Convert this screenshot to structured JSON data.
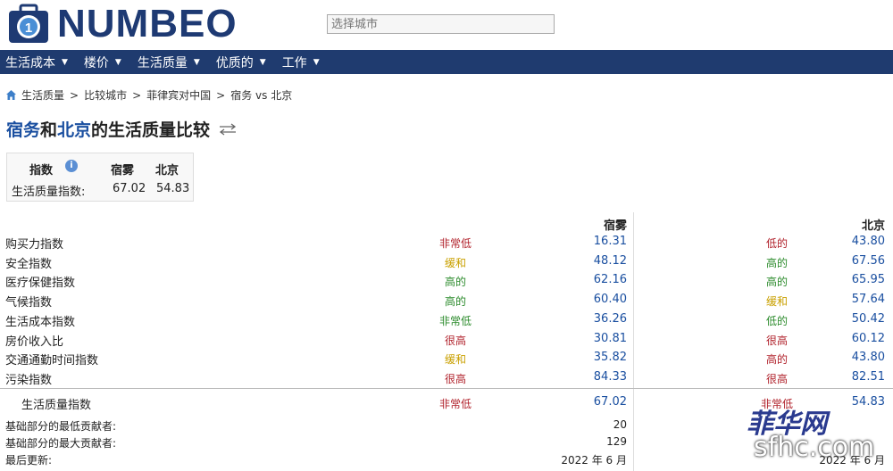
{
  "header": {
    "logo_text": "NUMBEO",
    "search_placeholder": "选择城市"
  },
  "nav": {
    "items": [
      {
        "label": "生活成本"
      },
      {
        "label": "楼价"
      },
      {
        "label": "生活质量"
      },
      {
        "label": "优质的"
      },
      {
        "label": "工作"
      }
    ]
  },
  "breadcrumb": {
    "items": [
      "生活质量",
      "比较城市",
      "菲律宾对中国",
      "宿务 vs 北京"
    ],
    "separator": ">"
  },
  "title": {
    "city1": "宿务",
    "connector": "和",
    "city2": "北京",
    "suffix": "的生活质量比较"
  },
  "summary": {
    "col_index": "指数",
    "col_city1": "宿雾",
    "col_city2": "北京",
    "row_label": "生活质量指数:",
    "val_city1": "67.02",
    "val_city2": "54.83"
  },
  "comparison": {
    "city1_header": "宿雾",
    "city2_header": "北京",
    "rows": [
      {
        "label": "购买力指数",
        "q1": "非常低",
        "q1_color": "#b0202a",
        "v1": "16.31",
        "q2": "低的",
        "q2_color": "#b0202a",
        "v2": "43.80"
      },
      {
        "label": "安全指数",
        "q1": "缓和",
        "q1_color": "#c9a000",
        "v1": "48.12",
        "q2": "高的",
        "q2_color": "#2a8a2a",
        "v2": "67.56"
      },
      {
        "label": "医疗保健指数",
        "q1": "高的",
        "q1_color": "#2a8a2a",
        "v1": "62.16",
        "q2": "高的",
        "q2_color": "#2a8a2a",
        "v2": "65.95"
      },
      {
        "label": "气候指数",
        "q1": "高的",
        "q1_color": "#2a8a2a",
        "v1": "60.40",
        "q2": "缓和",
        "q2_color": "#c9a000",
        "v2": "57.64"
      },
      {
        "label": "生活成本指数",
        "q1": "非常低",
        "q1_color": "#2a8a2a",
        "v1": "36.26",
        "q2": "低的",
        "q2_color": "#2a8a2a",
        "v2": "50.42"
      },
      {
        "label": "房价收入比",
        "q1": "很高",
        "q1_color": "#b0202a",
        "v1": "30.81",
        "q2": "很高",
        "q2_color": "#b0202a",
        "v2": "60.12"
      },
      {
        "label": "交通通勤时间指数",
        "q1": "缓和",
        "q1_color": "#c9a000",
        "v1": "35.82",
        "q2": "高的",
        "q2_color": "#b0202a",
        "v2": "43.80"
      },
      {
        "label": "污染指数",
        "q1": "很高",
        "q1_color": "#b0202a",
        "v1": "84.33",
        "q2": "很高",
        "q2_color": "#b0202a",
        "v2": "82.51"
      }
    ],
    "total": {
      "label": "生活质量指数",
      "q1": "非常低",
      "q1_color": "#b0202a",
      "v1": "67.02",
      "q2": "非常低",
      "q2_color": "#b0202a",
      "v2": "54.83"
    },
    "min_contrib": {
      "label": "基础部分的最低贡献者:",
      "v1": "20",
      "v2": ""
    },
    "max_contrib": {
      "label": "基础部分的最大贡献者:",
      "v1": "129",
      "v2": ""
    },
    "last_update": {
      "label": "最后更新:",
      "v1": "2022 年 6 月",
      "v2": "2022 年 6 月"
    }
  },
  "watermark": {
    "text": "菲华网",
    "sub": "sfhc.com"
  },
  "colors": {
    "brand_blue": "#1e3a73",
    "nav_bg": "#1f3b6f",
    "link_blue": "#1a4fa0"
  }
}
